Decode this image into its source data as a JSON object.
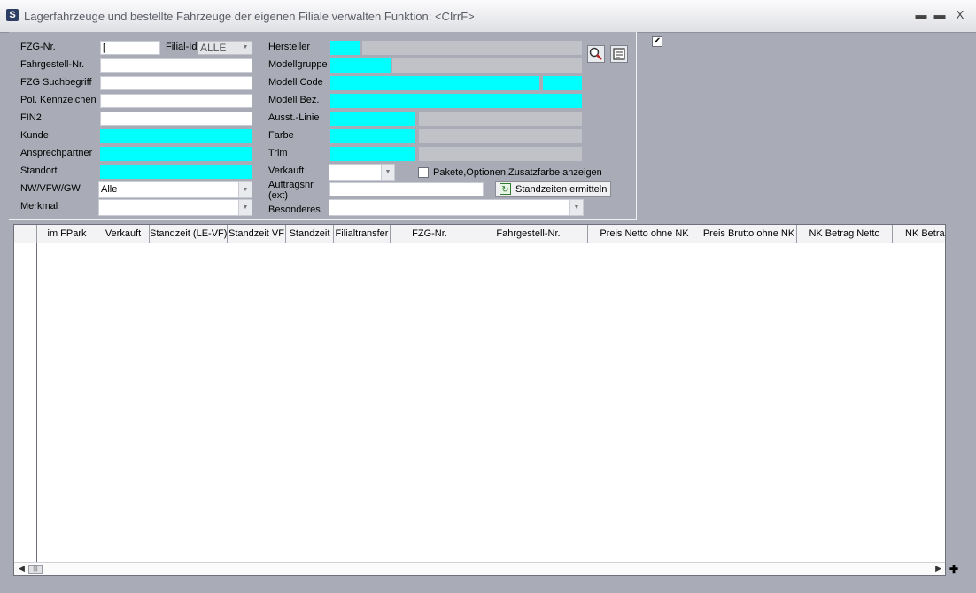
{
  "window": {
    "title": "Lagerfahrzeuge und bestellte Fahrzeuge der eigenen Filiale verwalten   Funktion: <CIrrF>",
    "app_icon": "S",
    "min": "▬",
    "max": "▬",
    "close": "X"
  },
  "form": {
    "fzg_nr": {
      "label": "FZG-Nr.",
      "value": "["
    },
    "filial_id": {
      "label": "Filial-Id",
      "value": "ALLE"
    },
    "fahrgestell": {
      "label": "Fahrgestell-Nr.",
      "value": ""
    },
    "suchbegriff": {
      "label": "FZG Suchbegriff",
      "value": ""
    },
    "kennzeichen": {
      "label": "Pol. Kennzeichen",
      "value": ""
    },
    "fin2": {
      "label": "FIN2",
      "value": ""
    },
    "kunde": {
      "label": "Kunde",
      "value": ""
    },
    "ansprechpartner": {
      "label": "Ansprechpartner",
      "value": ""
    },
    "standort": {
      "label": "Standort",
      "value": ""
    },
    "nw_vfw_gw": {
      "label": "NW/VFW/GW",
      "value": "Alle"
    },
    "merkmal": {
      "label": "Merkmal",
      "value": ""
    },
    "hersteller": {
      "label": "Hersteller"
    },
    "modellgruppe": {
      "label": "Modellgruppe"
    },
    "modell_code": {
      "label": "Modell Code"
    },
    "modell_bez": {
      "label": "Modell Bez."
    },
    "ausst_linie": {
      "label": "Ausst.-Linie"
    },
    "farbe": {
      "label": "Farbe"
    },
    "trim": {
      "label": "Trim"
    },
    "verkauft": {
      "label": "Verkauft",
      "value": ""
    },
    "pakete_checkbox": {
      "label": "Pakete,Optionen,Zusatzfarbe anzeigen",
      "checked": false
    },
    "auftragsnr": {
      "label_line1": "Auftragsnr",
      "label_line2": "(ext)",
      "value": ""
    },
    "standzeiten_button": {
      "label": "Standzeiten ermitteln"
    },
    "besonderes": {
      "label": "Besonderes",
      "value": ""
    },
    "top_checkbox": {
      "checked": true,
      "mark": "✔"
    }
  },
  "grid": {
    "columns": [
      "im FPark",
      "Verkauft",
      "Standzeit (LE-VF)",
      "Standzeit  VF",
      "Standzeit",
      "Filialtransfer",
      "FZG-Nr.",
      "Fahrgestell-Nr.",
      "Preis Netto ohne NK",
      "Preis Brutto ohne NK",
      "NK Betrag Netto",
      "NK Betra"
    ],
    "rows": []
  },
  "colors": {
    "background": "#a9acb6",
    "cyan_field": "#00ffff",
    "gray_field": "#c0c2c8"
  }
}
